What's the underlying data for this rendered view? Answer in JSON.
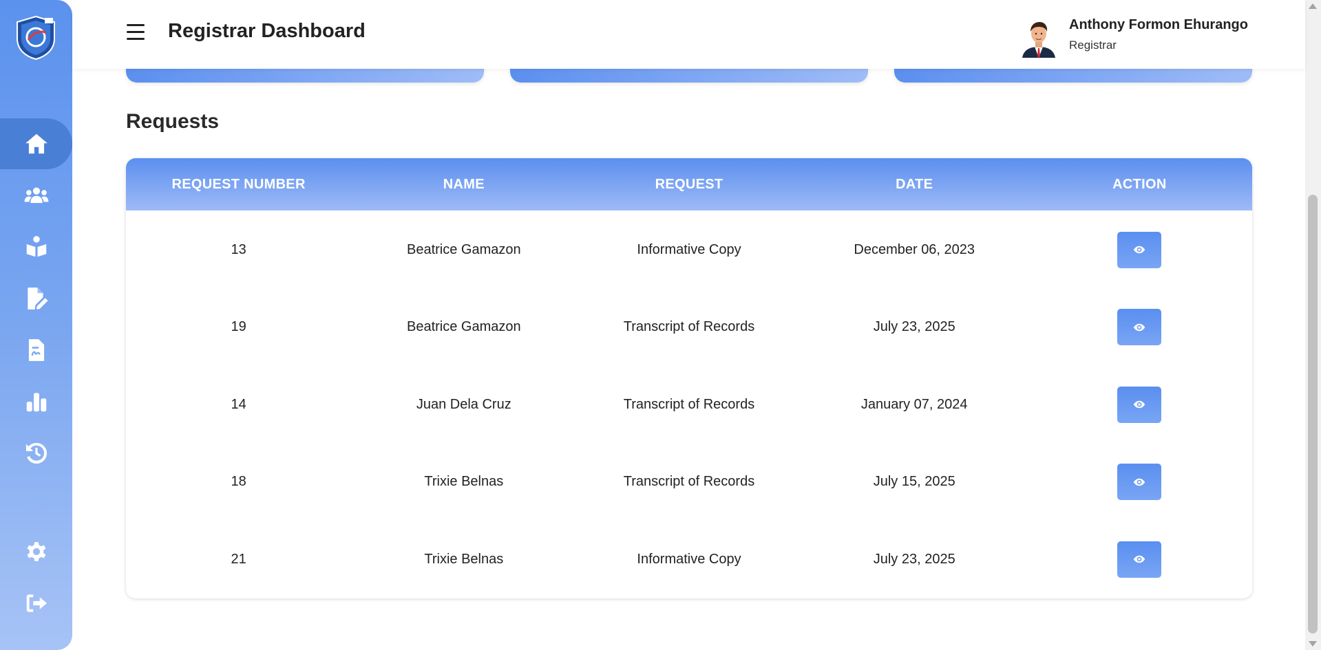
{
  "header": {
    "title": "Registrar Dashboard",
    "user_name": "Anthony Formon Ehurango",
    "user_role": "Registrar"
  },
  "sidebar": {
    "items": [
      {
        "icon": "home-icon",
        "active": true
      },
      {
        "icon": "users-icon",
        "active": false
      },
      {
        "icon": "reader-icon",
        "active": false
      },
      {
        "icon": "file-edit-icon",
        "active": false
      },
      {
        "icon": "file-signature-icon",
        "active": false
      },
      {
        "icon": "chart-icon",
        "active": false
      },
      {
        "icon": "history-icon",
        "active": false
      },
      {
        "icon": "gear-icon",
        "active": false
      },
      {
        "icon": "logout-icon",
        "active": false
      }
    ]
  },
  "requests": {
    "title": "Requests",
    "columns": [
      "REQUEST NUMBER",
      "NAME",
      "REQUEST",
      "DATE",
      "ACTION"
    ],
    "rows": [
      {
        "number": "13",
        "name": "Beatrice Gamazon",
        "request": "Informative Copy",
        "date": "December 06, 2023"
      },
      {
        "number": "19",
        "name": "Beatrice Gamazon",
        "request": "Transcript of Records",
        "date": "July 23, 2025"
      },
      {
        "number": "14",
        "name": "Juan Dela Cruz",
        "request": "Transcript of Records",
        "date": "January 07, 2024"
      },
      {
        "number": "18",
        "name": "Trixie Belnas",
        "request": "Transcript of Records",
        "date": "July 15, 2025"
      },
      {
        "number": "21",
        "name": "Trixie Belnas",
        "request": "Informative Copy",
        "date": "July 23, 2025"
      }
    ]
  },
  "colors": {
    "accent": "#5b8fef",
    "sidebar_active": "#4a7fd6"
  }
}
